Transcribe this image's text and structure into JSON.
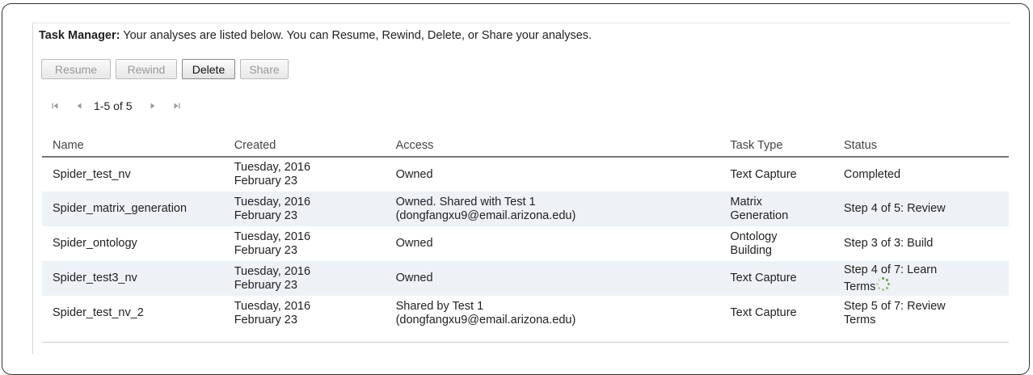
{
  "task_manager": {
    "heading_label": "Task Manager:",
    "heading_text": " Your analyses are listed below. You can Resume, Rewind, Delete, or Share your analyses."
  },
  "toolbar": {
    "resume_label": "Resume",
    "rewind_label": "Rewind",
    "delete_label": "Delete",
    "share_label": "Share"
  },
  "pager": {
    "range_text": "1-5 of 5"
  },
  "table": {
    "columns": {
      "name": "Name",
      "created": "Created",
      "access": "Access",
      "task_type": "Task Type",
      "status": "Status"
    },
    "rows": [
      {
        "name": "Spider_test_nv",
        "created_line1": "Tuesday, 2016",
        "created_line2": "February 23",
        "access_line1": "Owned",
        "access_line2": "",
        "task_type_line1": "Text Capture",
        "task_type_line2": "",
        "status_line1": "Completed",
        "status_line2": ""
      },
      {
        "name": "Spider_matrix_generation",
        "created_line1": "Tuesday, 2016",
        "created_line2": "February 23",
        "access_line1": "Owned. Shared with Test 1",
        "access_line2": "(dongfangxu9@email.arizona.edu)",
        "task_type_line1": "Matrix",
        "task_type_line2": "Generation",
        "status_line1": "Step 4 of 5: Review",
        "status_line2": ""
      },
      {
        "name": "Spider_ontology",
        "created_line1": "Tuesday, 2016",
        "created_line2": "February 23",
        "access_line1": "Owned",
        "access_line2": "",
        "task_type_line1": "Ontology",
        "task_type_line2": "Building",
        "status_line1": "Step 3 of 3: Build",
        "status_line2": ""
      },
      {
        "name": "Spider_test3_nv",
        "created_line1": "Tuesday, 2016",
        "created_line2": "February 23",
        "access_line1": "Owned",
        "access_line2": "",
        "task_type_line1": "Text Capture",
        "task_type_line2": "",
        "status_line1": "Step 4 of 7: Learn",
        "status_line2": "Terms"
      },
      {
        "name": "Spider_test_nv_2",
        "created_line1": "Tuesday, 2016",
        "created_line2": "February 23",
        "access_line1": "Shared by Test 1",
        "access_line2": "(dongfangxu9@email.arizona.edu)",
        "task_type_line1": "Text Capture",
        "task_type_line2": "",
        "status_line1": "Step 5 of 7: Review",
        "status_line2": "Terms"
      }
    ]
  },
  "icons": {
    "first_page": "first-page-icon",
    "prev_page": "prev-page-icon",
    "next_page": "next-page-icon",
    "last_page": "last-page-icon",
    "loading": "loading-spinner-icon"
  },
  "colors": {
    "row_alt": "#eef1f6",
    "spinner": "#5a9a2a",
    "disabled_text": "#999999"
  }
}
